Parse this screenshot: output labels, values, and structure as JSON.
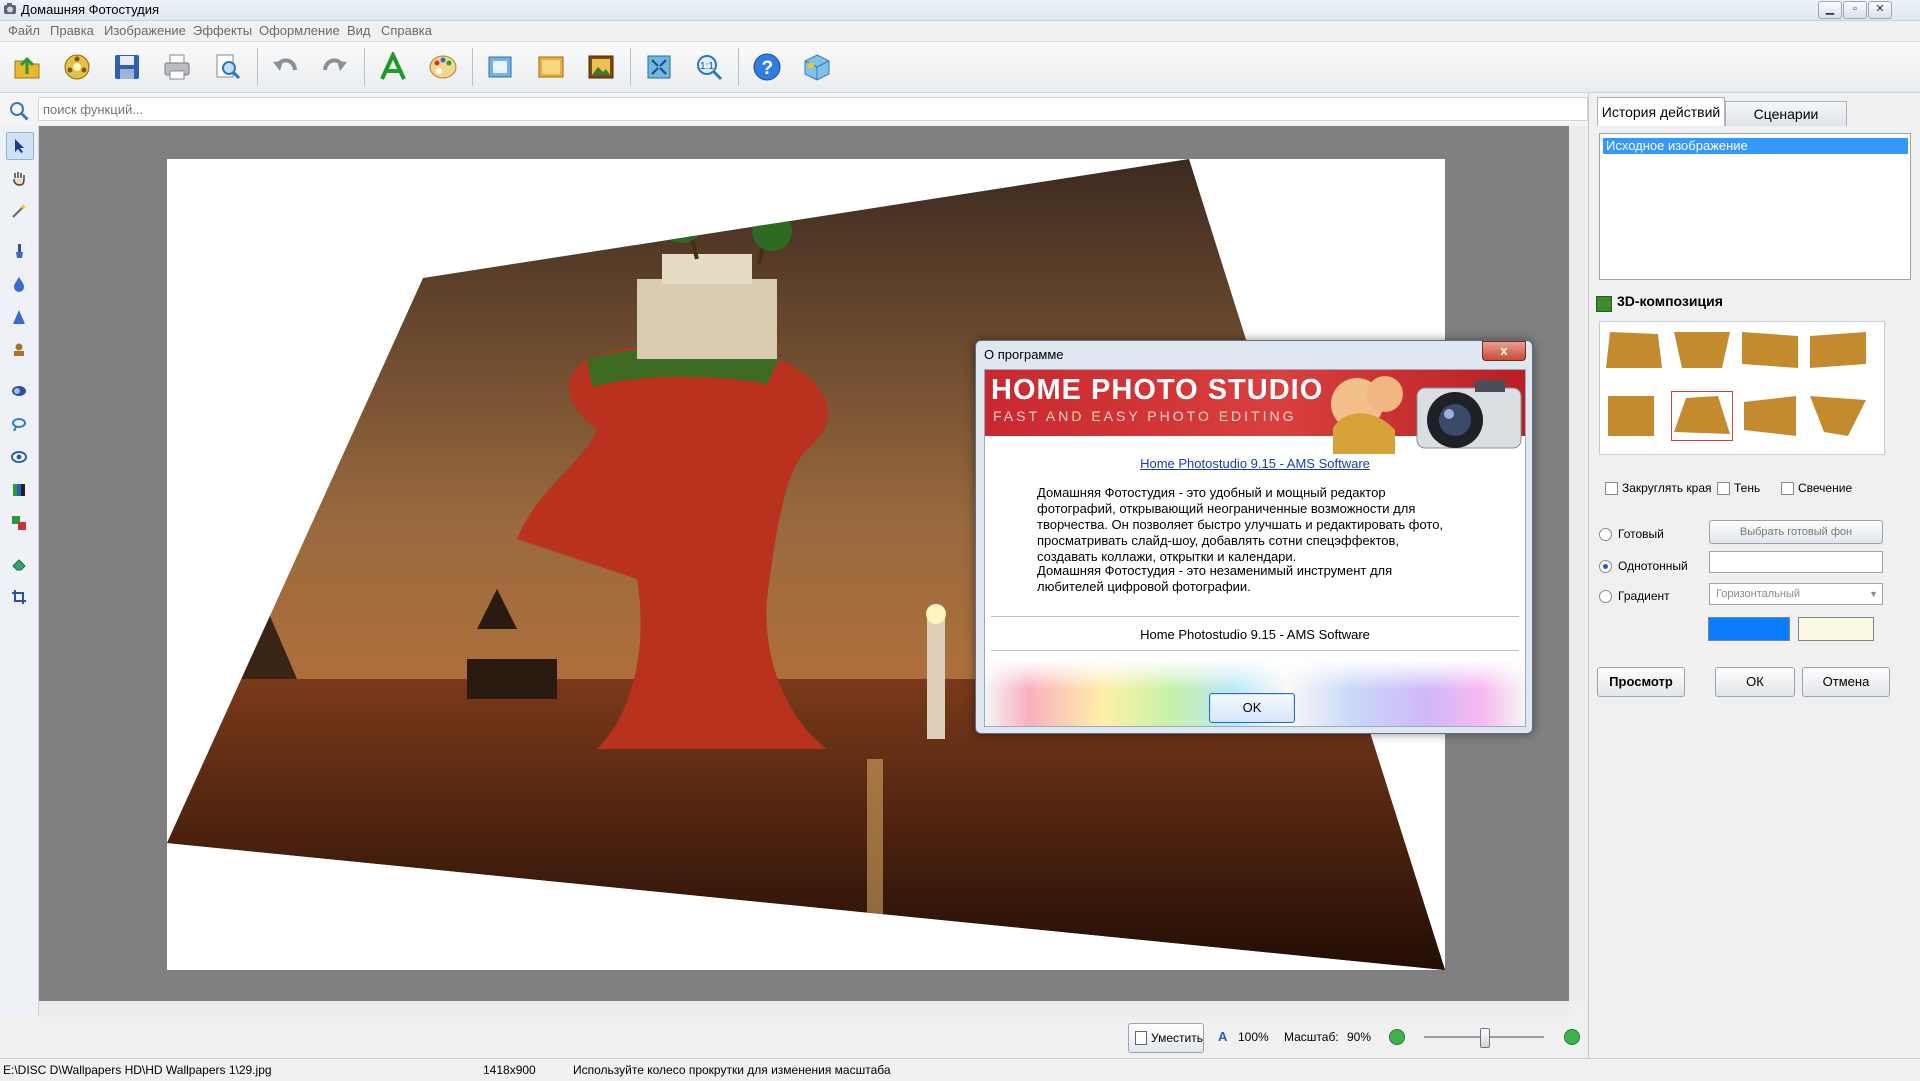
{
  "window": {
    "title": "Домашняя Фотостудия"
  },
  "menu": [
    "Файл",
    "Правка",
    "Изображение",
    "Эффекты",
    "Оформление",
    "Вид",
    "Справка"
  ],
  "toolbar_icons": [
    "open-icon",
    "effects-wheel-icon",
    "save-icon",
    "print-icon",
    "preview-icon",
    "undo-icon",
    "redo-icon",
    "text-icon",
    "palette-icon",
    "frames-icon",
    "backdrop-icon",
    "collage-icon",
    "fit-screen-icon",
    "actual-size-icon",
    "help-icon",
    "package-icon"
  ],
  "search": {
    "placeholder": "поиск функций..."
  },
  "left_tools": [
    "pointer-icon",
    "hand-icon",
    "magic-wand-icon",
    "brush-icon",
    "drop-icon",
    "cone-icon",
    "stamp-icon",
    "lens-icon",
    "lasso-icon",
    "eye-icon",
    "levels-icon",
    "swap-icon",
    "eraser-icon",
    "crop-icon"
  ],
  "right_panel": {
    "tabs": [
      "История действий",
      "Сценарии"
    ],
    "history_items": [
      "Исходное изображение"
    ],
    "section_title": "3D-композиция",
    "options": {
      "round_edges": "Закруглять края",
      "shadow": "Тень",
      "glow": "Свечение"
    },
    "bg_ready": "Готовый",
    "bg_ready_button": "Выбрать готовый фон",
    "bg_solid": "Однотонный",
    "bg_gradient": "Градиент",
    "gradient_value": "Горизонтальный",
    "color1": "#0a7cff",
    "color2": "#fbf8e4",
    "preview_btn": "Просмотр",
    "ok_btn": "ОК",
    "cancel_btn": "Отмена"
  },
  "dialog": {
    "title": "О программе",
    "close": "x",
    "banner_title": "HOME PHOTO STUDIO",
    "banner_subtitle": "FAST AND EASY PHOTO EDITING",
    "link": "Home Photostudio 9.15 - AMS Software",
    "para1": "Домашняя Фотостудия - это удобный и мощный редактор фотографий, открывающий неограниченные возможности для творчества. Он позволяет быстро улучшать и редактировать фото, просматривать слайд-шоу, добавлять сотни спецэффектов, создавать коллажи, открытки и календари.",
    "para2": "Домашняя Фотостудия - это незаменимый инструмент для любителей цифровой фотографии.",
    "footer": "Home Photostudio 9.15 - AMS Software",
    "ok": "OK"
  },
  "zoombar": {
    "fit": "Уместить",
    "actual": "100%",
    "scale_label": "Масштаб:",
    "scale_value": "90%",
    "slider_level": 0.5
  },
  "status": {
    "path": "E:\\DISC D\\Wallpapers HD\\HD Wallpapers 1\\29.jpg",
    "size": "1418x900",
    "hint": "Используйте колесо прокрутки для изменения масштаба"
  }
}
